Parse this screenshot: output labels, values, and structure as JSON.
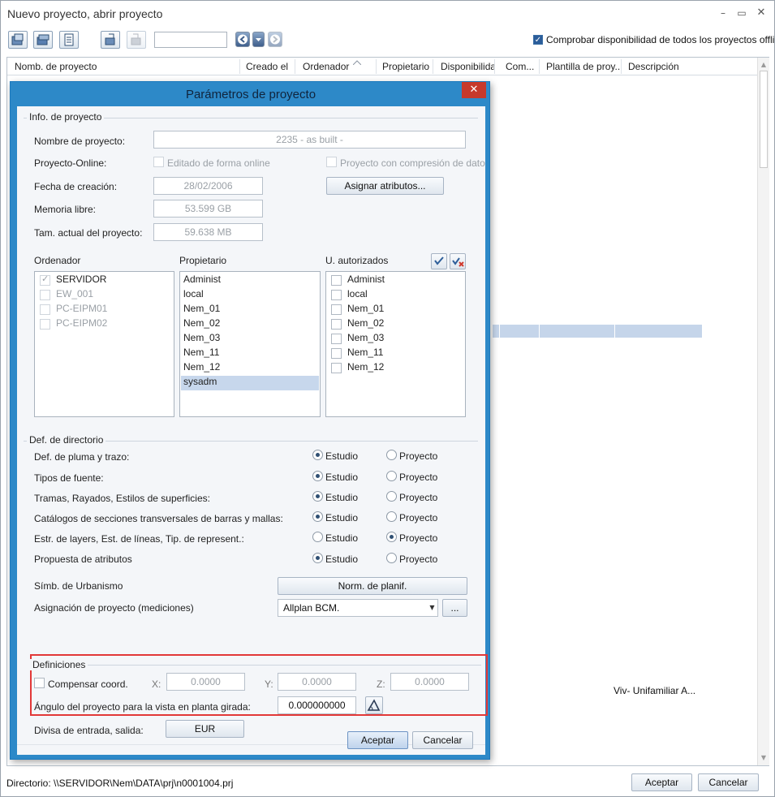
{
  "window": {
    "title": "Nuevo proyecto, abrir proyecto",
    "offline_check_label": "Comprobar disponibilidad de todos los proyectos offline",
    "columns": [
      "Nomb. de proyecto",
      "Creado el",
      "Ordenador",
      "Propietario",
      "Disponibilidad",
      "Com...",
      "Plantilla de proy...",
      "Descripción"
    ],
    "row_description": "Viv- Unifamiliar A...",
    "directory": "Directorio: \\\\SERVIDOR\\Nem\\DATA\\prj\\n0001004.prj",
    "accept_button": "Aceptar",
    "cancel_button": "Cancelar"
  },
  "dialog": {
    "title": "Parámetros de proyecto",
    "info_section": "Info. de proyecto",
    "project_name_label": "Nombre de proyecto:",
    "project_name_value": "2235 - as built -",
    "online_label": "Proyecto-Online:",
    "online_check_label": "Editado de forma online",
    "compression_label": "Proyecto con compresión de dato",
    "creation_date_label": "Fecha de creación:",
    "creation_date_value": "28/02/2006",
    "assign_attributes_button": "Asignar atributos...",
    "free_memory_label": "Memoria libre:",
    "free_memory_value": "53.599 GB",
    "project_size_label": "Tam. actual del proyecto:",
    "project_size_value": "59.638 MB",
    "computer_header": "Ordenador",
    "owner_header": "Propietario",
    "authorized_header": "U. autorizados",
    "computers": [
      "SERVIDOR",
      "EW_001",
      "PC-EIPM01",
      "PC-EIPM02"
    ],
    "owners": [
      "Administ",
      "local",
      "Nem_01",
      "Nem_02",
      "Nem_03",
      "Nem_11",
      "Nem_12",
      "sysadm"
    ],
    "authorized": [
      "Administ",
      "local",
      "Nem_01",
      "Nem_02",
      "Nem_03",
      "Nem_11",
      "Nem_12"
    ],
    "dir_section": "Def. de directorio",
    "opt_studio": "Estudio",
    "opt_project": "Proyecto",
    "dir_rows": [
      {
        "label": "Def. de pluma y trazo:",
        "selected": "Estudio"
      },
      {
        "label": "Tipos de fuente:",
        "selected": "Estudio"
      },
      {
        "label": "Tramas, Rayados, Estilos de superficies:",
        "selected": "Estudio"
      },
      {
        "label": "Catálogos de secciones transversales de barras y mallas:",
        "selected": "Estudio"
      },
      {
        "label": "Estr. de layers, Est. de líneas, Tip. de represent.:",
        "selected": "Proyecto"
      },
      {
        "label": "Propuesta de atributos",
        "selected": "Estudio"
      }
    ],
    "urbanism_label": "Símb. de Urbanismo",
    "urbanism_button": "Norm. de planif.",
    "assignment_label": "Asignación de proyecto (mediciones)",
    "assignment_value": "Allplan BCM.",
    "assignment_more": "...",
    "definitions_section": "Definiciones",
    "compensate_label": "Compensar coord.",
    "x_label": "X:",
    "x_value": "0.0000",
    "y_label": "Y:",
    "y_value": "0.0000",
    "z_label": "Z:",
    "z_value": "0.0000",
    "angle_label": "Ángulo del proyecto para la vista en planta girada:",
    "angle_value": "0.000000000",
    "currency_label": "Divisa de entrada, salida:",
    "currency_button": "EUR",
    "accept_button": "Aceptar",
    "cancel_button": "Cancelar"
  },
  "colors": {
    "dialog_frame": "#2d89c8",
    "close_red": "#c7392b",
    "highlight_red": "#e23838",
    "selection": "#c7d7ec"
  }
}
